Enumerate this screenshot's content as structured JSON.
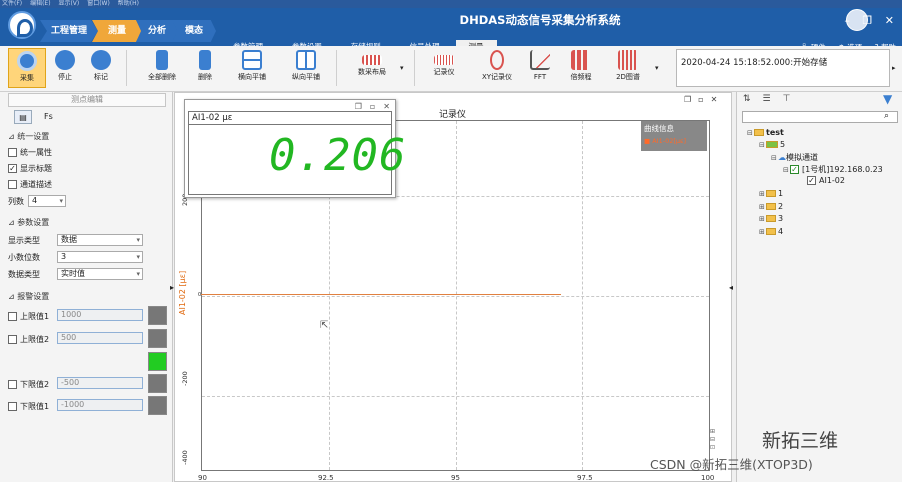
{
  "menubar": [
    "文件(F)",
    "编辑(E)",
    "显示(V)",
    "窗口(W)",
    "帮助(H)"
  ],
  "app_title": "DHDAS动态信号采集分析系统",
  "steps": [
    {
      "label": "工程管理",
      "active": false
    },
    {
      "label": "测量",
      "active": true
    },
    {
      "label": "分析",
      "active": false
    },
    {
      "label": "模态",
      "active": false
    }
  ],
  "ribbon_tabs": [
    {
      "label": "参数管理",
      "active": false
    },
    {
      "label": "参数设置",
      "active": false
    },
    {
      "label": "存储规则",
      "active": false
    },
    {
      "label": "信号处理",
      "active": false
    },
    {
      "label": "测量",
      "active": true
    }
  ],
  "top_links": [
    "硬件",
    "选项",
    "帮助"
  ],
  "window_controls": [
    "–",
    "❐",
    "✕"
  ],
  "toolbar": {
    "buttons": [
      "采集",
      "停止",
      "标记",
      "全部删除",
      "删除",
      "横向平铺",
      "纵向平铺",
      "数采布局",
      "记录仪",
      "XY记录仪",
      "FFT",
      "倍频程",
      "2D图谱"
    ],
    "status_text": "2020-04-24 15:18:52.000:开始存储"
  },
  "left": {
    "title": "测点编辑",
    "tab_fs": "Fs",
    "section_unify": "统一设置",
    "checks": [
      {
        "label": "统一属性",
        "checked": false
      },
      {
        "label": "显示标题",
        "checked": true
      },
      {
        "label": "通道描述",
        "checked": false
      }
    ],
    "cols_label": "列数",
    "cols_value": "4",
    "section_params": "参数设置",
    "params": [
      {
        "label": "显示类型",
        "value": "数据"
      },
      {
        "label": "小数位数",
        "value": "3"
      },
      {
        "label": "数据类型",
        "value": "实时值"
      }
    ],
    "section_alarm": "报警设置",
    "alarms": [
      {
        "label": "上限值1",
        "value": "1000",
        "color": "#7a7a7a"
      },
      {
        "label": "上限值2",
        "value": "500",
        "color": "#7a7a7a"
      },
      {
        "label": "",
        "value": "",
        "color": "#22cc22"
      },
      {
        "label": "下限值2",
        "value": "-500",
        "color": "#7a7a7a"
      },
      {
        "label": "下限值1",
        "value": "-1000",
        "color": "#7a7a7a"
      }
    ]
  },
  "chart_data": {
    "type": "line",
    "title": "记录仪",
    "ylabel": "AI1-02 [µε]",
    "xlabel": "",
    "xlim": [
      90,
      100
    ],
    "ylim": [
      -400,
      300
    ],
    "x_ticks": [
      "90",
      "92.5",
      "95",
      "97.5",
      "100"
    ],
    "y_ticks": [
      "200",
      "0",
      "-200",
      "-400"
    ],
    "series": [
      {
        "name": "AI1-02[µε]",
        "color": "#e08040",
        "x": [
          90,
          97
        ],
        "y": [
          0,
          0
        ]
      }
    ],
    "legend": {
      "title": "曲线信息",
      "entries": [
        "AI1-02[µε]"
      ],
      "placement": "top-right"
    },
    "grid": true
  },
  "meter": {
    "channel": "AI1-02  µε",
    "value": "0.206",
    "value_color": "#22b722"
  },
  "right": {
    "tree": [
      {
        "label": "test",
        "indent": 0,
        "folder": true
      },
      {
        "label": "5",
        "indent": 1,
        "folder": true
      },
      {
        "label": "模拟通道",
        "indent": 2,
        "folder": false
      },
      {
        "label": "[1号机]192.168.0.23",
        "indent": 3,
        "folder": false
      },
      {
        "label": "AI1-02",
        "indent": 4,
        "folder": false
      },
      {
        "label": "1",
        "indent": 1,
        "folder": true
      },
      {
        "label": "2",
        "indent": 1,
        "folder": true
      },
      {
        "label": "3",
        "indent": 1,
        "folder": true
      },
      {
        "label": "4",
        "indent": 1,
        "folder": true
      }
    ]
  },
  "watermark": {
    "brand": "新拓三维",
    "credit": "CSDN @新拓三维(XTOP3D)"
  }
}
